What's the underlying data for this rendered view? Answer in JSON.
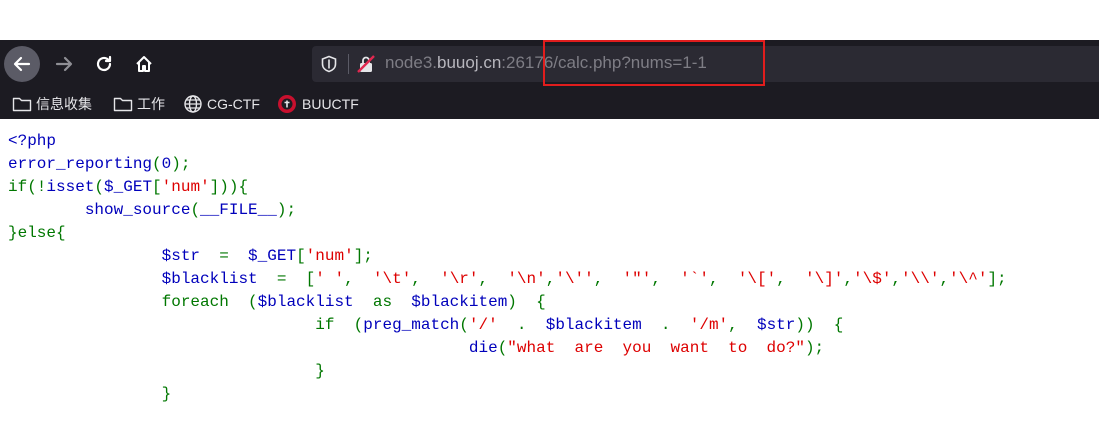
{
  "browser": {
    "url_host_prefix": "node3.",
    "url_host_main": "buuoj.cn",
    "url_rest": ":26176/calc.php?nums=1-1"
  },
  "icons": {
    "back": "arrow-left-icon",
    "forward": "arrow-right-icon",
    "reload": "reload-icon",
    "home": "home-icon",
    "tracking": "shield-icon",
    "insecure": "crossed-lock-icon",
    "folder": "folder-icon",
    "globe": "globe-icon",
    "buuctf": "buuctf-logo-icon"
  },
  "bookmarks": [
    {
      "label": "信息收集"
    },
    {
      "label": "工作"
    },
    {
      "label": "CG-CTF"
    },
    {
      "label": "BUUCTF"
    }
  ],
  "code_lines": [
    [
      {
        "t": "d",
        "v": "<?php"
      }
    ],
    [
      {
        "t": "d",
        "v": "error_reporting"
      },
      {
        "t": "k",
        "v": "("
      },
      {
        "t": "d",
        "v": "0"
      },
      {
        "t": "k",
        "v": ");"
      }
    ],
    [
      {
        "t": "k",
        "v": "if(!"
      },
      {
        "t": "d",
        "v": "isset"
      },
      {
        "t": "k",
        "v": "("
      },
      {
        "t": "d",
        "v": "$_GET"
      },
      {
        "t": "k",
        "v": "["
      },
      {
        "t": "s",
        "v": "'num'"
      },
      {
        "t": "k",
        "v": "])){"
      }
    ],
    [
      {
        "t": "k",
        "v": "        "
      },
      {
        "t": "d",
        "v": "show_source"
      },
      {
        "t": "k",
        "v": "("
      },
      {
        "t": "d",
        "v": "__FILE__"
      },
      {
        "t": "k",
        "v": ");"
      }
    ],
    [
      {
        "t": "k",
        "v": "}else{"
      }
    ],
    [
      {
        "t": "k",
        "v": "                "
      },
      {
        "t": "d",
        "v": "$str "
      },
      {
        "t": "k",
        "v": " = "
      },
      {
        "t": "d",
        "v": " $_GET"
      },
      {
        "t": "k",
        "v": "["
      },
      {
        "t": "s",
        "v": "'num'"
      },
      {
        "t": "k",
        "v": "];"
      }
    ],
    [
      {
        "t": "k",
        "v": "                "
      },
      {
        "t": "d",
        "v": "$blacklist "
      },
      {
        "t": "k",
        "v": " = "
      },
      {
        "t": "k",
        "v": " ["
      },
      {
        "t": "s",
        "v": "' '"
      },
      {
        "t": "k",
        "v": ", "
      },
      {
        "t": "s",
        "v": " '\\t'"
      },
      {
        "t": "k",
        "v": ", "
      },
      {
        "t": "s",
        "v": " '\\r'"
      },
      {
        "t": "k",
        "v": ", "
      },
      {
        "t": "s",
        "v": " '\\n'"
      },
      {
        "t": "k",
        "v": ","
      },
      {
        "t": "s",
        "v": "'\\''"
      },
      {
        "t": "k",
        "v": ", "
      },
      {
        "t": "s",
        "v": " '\"'"
      },
      {
        "t": "k",
        "v": ", "
      },
      {
        "t": "s",
        "v": " '`'"
      },
      {
        "t": "k",
        "v": ", "
      },
      {
        "t": "s",
        "v": " '\\['"
      },
      {
        "t": "k",
        "v": ", "
      },
      {
        "t": "s",
        "v": " '\\]'"
      },
      {
        "t": "k",
        "v": ","
      },
      {
        "t": "s",
        "v": "'\\$'"
      },
      {
        "t": "k",
        "v": ","
      },
      {
        "t": "s",
        "v": "'\\\\'"
      },
      {
        "t": "k",
        "v": ","
      },
      {
        "t": "s",
        "v": "'\\^'"
      },
      {
        "t": "k",
        "v": "];"
      }
    ],
    [
      {
        "t": "k",
        "v": "                foreach "
      },
      {
        "t": "k",
        "v": " ("
      },
      {
        "t": "d",
        "v": "$blacklist "
      },
      {
        "t": "k",
        "v": " as "
      },
      {
        "t": "d",
        "v": " $blackitem"
      },
      {
        "t": "k",
        "v": ") "
      },
      {
        "t": "k",
        "v": " {"
      }
    ],
    [
      {
        "t": "k",
        "v": "                                if "
      },
      {
        "t": "k",
        "v": " ("
      },
      {
        "t": "d",
        "v": "preg_match"
      },
      {
        "t": "k",
        "v": "("
      },
      {
        "t": "s",
        "v": "'/' "
      },
      {
        "t": "k",
        "v": " . "
      },
      {
        "t": "d",
        "v": " $blackitem "
      },
      {
        "t": "k",
        "v": " . "
      },
      {
        "t": "s",
        "v": " '/m'"
      },
      {
        "t": "k",
        "v": ", "
      },
      {
        "t": "d",
        "v": " $str"
      },
      {
        "t": "k",
        "v": ")) "
      },
      {
        "t": "k",
        "v": " {"
      }
    ],
    [
      {
        "t": "k",
        "v": "                                                "
      },
      {
        "t": "d",
        "v": "die"
      },
      {
        "t": "k",
        "v": "("
      },
      {
        "t": "s",
        "v": "\"what  are  you  want  to  do?\""
      },
      {
        "t": "k",
        "v": ");"
      }
    ],
    [
      {
        "t": "k",
        "v": "                                }"
      }
    ],
    [
      {
        "t": "k",
        "v": "                }"
      }
    ]
  ]
}
